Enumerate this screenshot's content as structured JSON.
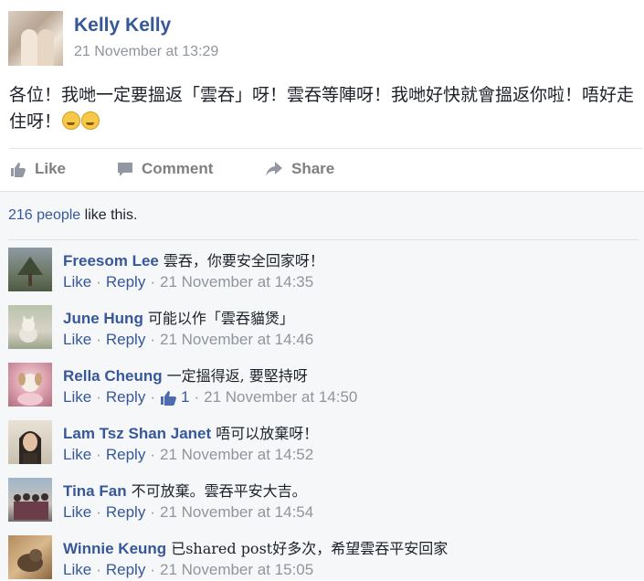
{
  "post": {
    "author": "Kelly Kelly",
    "timestamp": "21 November at 13:29",
    "text": "各位！我哋一定要搵返「雲吞」呀！雲吞等陣呀！我哋好快就會搵返你啦！唔好走住呀！",
    "emojis": [
      "crying-face",
      "loudly-crying-face"
    ]
  },
  "actions": {
    "like": "Like",
    "comment": "Comment",
    "share": "Share"
  },
  "likes": {
    "count_link": "216 people",
    "suffix": " like this."
  },
  "comment_actions": {
    "like": "Like",
    "reply": "Reply",
    "sep": "·"
  },
  "comments": [
    {
      "name": "Freesom Lee",
      "text": "雲吞，你要安全回家呀！",
      "time": "21 November at 14:35"
    },
    {
      "name": "June Hung",
      "text": "可能以作「雲吞貓煲」",
      "time": "21 November at 14:46"
    },
    {
      "name": "Rella Cheung",
      "text": "一定搵得返, 要堅持呀",
      "likes": "1",
      "time": "21 November at 14:50"
    },
    {
      "name": "Lam Tsz Shan Janet",
      "text": "唔可以放棄呀！",
      "time": "21 November at 14:52"
    },
    {
      "name": "Tina Fan",
      "text": "不可放棄。雲吞平安大吉。",
      "time": "21 November at 14:54"
    },
    {
      "name": "Winnie Keung",
      "text": "已shared post好多次，希望雲吞平安回家",
      "time": "21 November at 15:05"
    }
  ],
  "colors": {
    "link": "#365899",
    "meta": "#90949c",
    "action": "#7f7f7f",
    "feedback_bg": "#f6f7f9"
  }
}
